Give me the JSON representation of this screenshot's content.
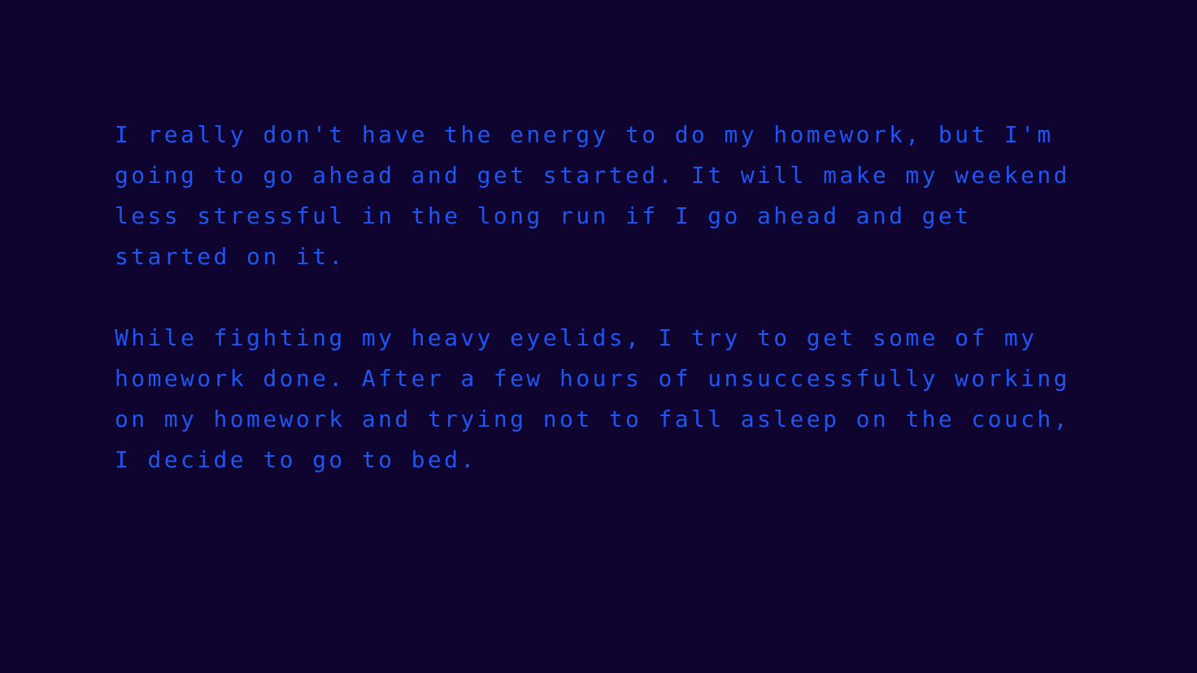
{
  "colors": {
    "background": "#0f0330",
    "text": "#1f55f0"
  },
  "story": {
    "paragraphs": [
      {
        "lines": [
          "I really don't have the energy to do my homework, but I'm",
          "going to go ahead and get started. It will make my weekend",
          "less stressful in the long run if I go ahead and get",
          "started on it."
        ]
      },
      {
        "lines": [
          "While fighting my heavy eyelids, I try to get some of my",
          "homework done. After a few hours of unsuccessfully working",
          "on my homework and trying not to fall asleep on the couch,",
          "I decide to go to bed."
        ]
      }
    ]
  }
}
